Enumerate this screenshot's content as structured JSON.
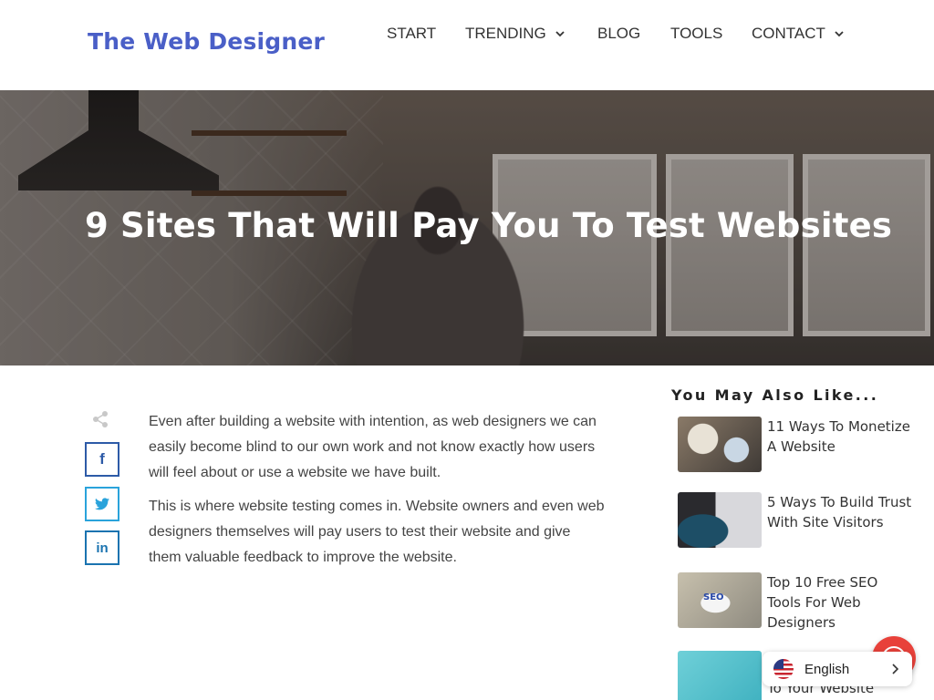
{
  "header": {
    "logo": "The Web Designer",
    "nav": {
      "start": "START",
      "trending": "TRENDING",
      "blog": "BLOG",
      "tools": "TOOLS",
      "contact": "CONTACT"
    }
  },
  "hero": {
    "title": "9 Sites That Will Pay You To Test Websites"
  },
  "article": {
    "paragraphs": [
      "Even after building a website with intention, as web designers we can easily become blind to our own work and not know exactly how users will feel about or use a website we have built.",
      "This is where website testing comes in. Website owners and even web designers themselves will pay users to test their website and give them valuable feedback to improve the website."
    ]
  },
  "share": {
    "facebook": "f",
    "twitter": "t",
    "linkedin": "in"
  },
  "sidebar": {
    "heading": "You May Also Like...",
    "items": [
      {
        "title": "11 Ways To Monetize A Website"
      },
      {
        "title": "5 Ways To Build Trust With Site Visitors"
      },
      {
        "title": "Top 10 Free SEO Tools For Web Designers",
        "thumb_text": "SEO"
      },
      {
        "title": "To Your Website"
      }
    ]
  },
  "language": {
    "label": "English"
  },
  "colors": {
    "logo": "#4a5fc7",
    "facebook": "#2d5aa7",
    "twitter": "#2aa3db",
    "linkedin": "#1a73b0",
    "help": "#e8413a"
  }
}
